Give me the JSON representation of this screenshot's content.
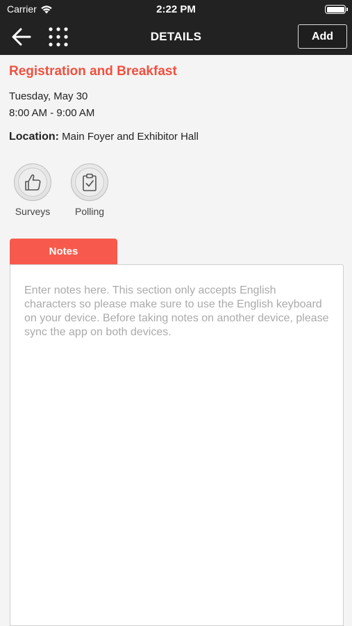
{
  "status_bar": {
    "carrier": "Carrier",
    "time": "2:22 PM"
  },
  "nav": {
    "title": "DETAILS",
    "add_label": "Add"
  },
  "session": {
    "title": "Registration and Breakfast",
    "date": "Tuesday, May 30",
    "time_range": "8:00 AM - 9:00 AM",
    "location_label": "Location:",
    "location_value": "Main Foyer and Exhibitor Hall"
  },
  "actions": [
    {
      "label": "Surveys",
      "icon": "thumbs-up-icon"
    },
    {
      "label": "Polling",
      "icon": "clipboard-check-icon"
    }
  ],
  "notes": {
    "tab_label": "Notes",
    "value": "",
    "placeholder": "Enter notes here. This section only accepts English characters so please make sure to use the English keyboard on your device. Before taking notes on another device, please sync the app on both devices."
  },
  "colors": {
    "accent": "#f75a4c",
    "title_red": "#f0503f",
    "navbar": "#222222",
    "background": "#f4f4f4"
  }
}
